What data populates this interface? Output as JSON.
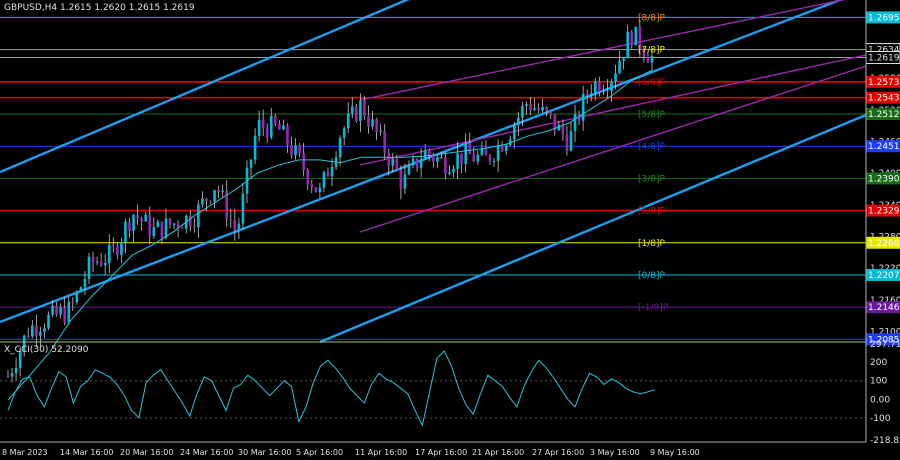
{
  "chart_data": [
    {
      "type": "candlestick",
      "title": "GBPUSD,H4  1.2615 1.2620 1.2615 1.2619",
      "price_range": [
        1.208,
        1.2728
      ],
      "right_axis_ticks": [
        "1.2100",
        "1.2160",
        "1.2220",
        "1.2280",
        "1.2340",
        "1.2400",
        "1.2460",
        "1.2520",
        "1.2580",
        "1.2640",
        "1.2700"
      ],
      "price_labels": [
        {
          "value": 1.2695,
          "text": "1.2695",
          "color": "#00bcd4"
        },
        {
          "value": 1.2634,
          "text": "1.2634",
          "color": "#e0e0e0"
        },
        {
          "value": 1.2619,
          "text": "1.2619",
          "color": "#e0e0e0"
        },
        {
          "value": 1.2573,
          "text": "1.2573",
          "color": "#e00000"
        },
        {
          "value": 1.2543,
          "text": "1.2543",
          "color": "#e00000"
        },
        {
          "value": 1.2512,
          "text": "1.2512",
          "color": "#1a6b1a"
        },
        {
          "value": 1.2451,
          "text": "1.2451",
          "color": "#1e3cff"
        },
        {
          "value": 1.239,
          "text": "1.2390",
          "color": "#1a6b1a"
        },
        {
          "value": 1.2329,
          "text": "1.2329",
          "color": "#e00000"
        },
        {
          "value": 1.2268,
          "text": "1.2268",
          "color": "#e8e800"
        },
        {
          "value": 1.2207,
          "text": "1.2207",
          "color": "#00bcd4"
        },
        {
          "value": 1.2146,
          "text": "1.2146",
          "color": "#6a1b9a"
        },
        {
          "value": 1.2085,
          "text": "1.2085",
          "color": "#1e3cff"
        }
      ],
      "murrey_levels": [
        {
          "label": "[8/8]P",
          "value": 1.2695,
          "color": "#ff8c00"
        },
        {
          "label": "[7/8]P",
          "value": 1.2634,
          "color": "#e8e800"
        },
        {
          "label": "[6/8]P",
          "value": 1.2573,
          "color": "#e00000"
        },
        {
          "label": "[5/8]P",
          "value": 1.2512,
          "color": "#1a8a1a"
        },
        {
          "label": "[4/8]P",
          "value": 1.2451,
          "color": "#1e3cff"
        },
        {
          "label": "[3/8]P",
          "value": 1.239,
          "color": "#1a8a1a"
        },
        {
          "label": "[2/8]P",
          "value": 1.2329,
          "color": "#e00000"
        },
        {
          "label": "[1/8]P",
          "value": 1.2268,
          "color": "#e8e800"
        },
        {
          "label": "[0/8]P",
          "value": 1.2207,
          "color": "#00bcd4"
        },
        {
          "label": "[-1/8]P",
          "value": 1.2146,
          "color": "#6a1b9a"
        }
      ],
      "x_labels": [
        "8 Mar 2023",
        "14 Mar 16:00",
        "20 Mar 16:00",
        "24 Mar 16:00",
        "30 Mar 16:00",
        "5 Apr 16:00",
        "11 Apr 16:00",
        "17 Apr 16:00",
        "21 Apr 16:00",
        "27 Apr 16:00",
        "3 May 16:00",
        "9 May 16:00"
      ],
      "series": [
        {
          "name": "GBPUSD close path",
          "values": [
            1.2015,
            1.2105,
            1.2125,
            1.214,
            1.223,
            1.2245,
            1.2325,
            1.229,
            1.2305,
            1.232,
            1.238,
            1.2285,
            1.249,
            1.2485,
            1.2425,
            1.236,
            1.2475,
            1.253,
            1.2455,
            1.238,
            1.244,
            1.242,
            1.2435,
            1.2425,
            1.247,
            1.2535,
            1.2505,
            1.246,
            1.2565,
            1.258,
            1.2665,
            1.2619
          ]
        },
        {
          "name": "moving average",
          "values": [
            1.197,
            1.2015,
            1.206,
            1.212,
            1.2165,
            1.2205,
            1.2245,
            1.2265,
            1.229,
            1.232,
            1.2345,
            1.237,
            1.24,
            1.2415,
            1.2425,
            1.2425,
            1.242,
            1.243,
            1.243,
            1.243,
            1.2432,
            1.2437,
            1.2442,
            1.2447,
            1.2455,
            1.247,
            1.248,
            1.2495,
            1.252,
            1.2545,
            1.2575,
            1.2595
          ]
        }
      ]
    },
    {
      "type": "line",
      "title": "X_CCI(30) 52.2090",
      "ylim": [
        -218.83,
        297.7123
      ],
      "left_axis_ticks": [
        "297.7123",
        "200",
        "100",
        "0.00",
        "-100",
        "-218.8300"
      ],
      "tick_values": [
        297.7123,
        200,
        100,
        0,
        -100,
        -218.83
      ],
      "series": [
        {
          "name": "CCI",
          "values": [
            -60,
            40,
            110,
            120,
            20,
            -40,
            60,
            150,
            120,
            -20,
            70,
            100,
            160,
            140,
            120,
            80,
            20,
            -60,
            -100,
            90,
            130,
            160,
            100,
            40,
            -20,
            -90,
            30,
            120,
            100,
            20,
            -60,
            60,
            80,
            130,
            100,
            60,
            20,
            60,
            100,
            70,
            -120,
            -40,
            90,
            180,
            210,
            170,
            120,
            60,
            20,
            -20,
            80,
            140,
            110,
            90,
            60,
            30,
            -60,
            -140,
            40,
            220,
            260,
            180,
            60,
            -30,
            -80,
            30,
            130,
            100,
            70,
            10,
            -40,
            70,
            150,
            210,
            170,
            120,
            60,
            0,
            -40,
            60,
            140,
            120,
            80,
            110,
            90,
            60,
            40,
            30,
            40,
            52
          ]
        }
      ]
    }
  ]
}
